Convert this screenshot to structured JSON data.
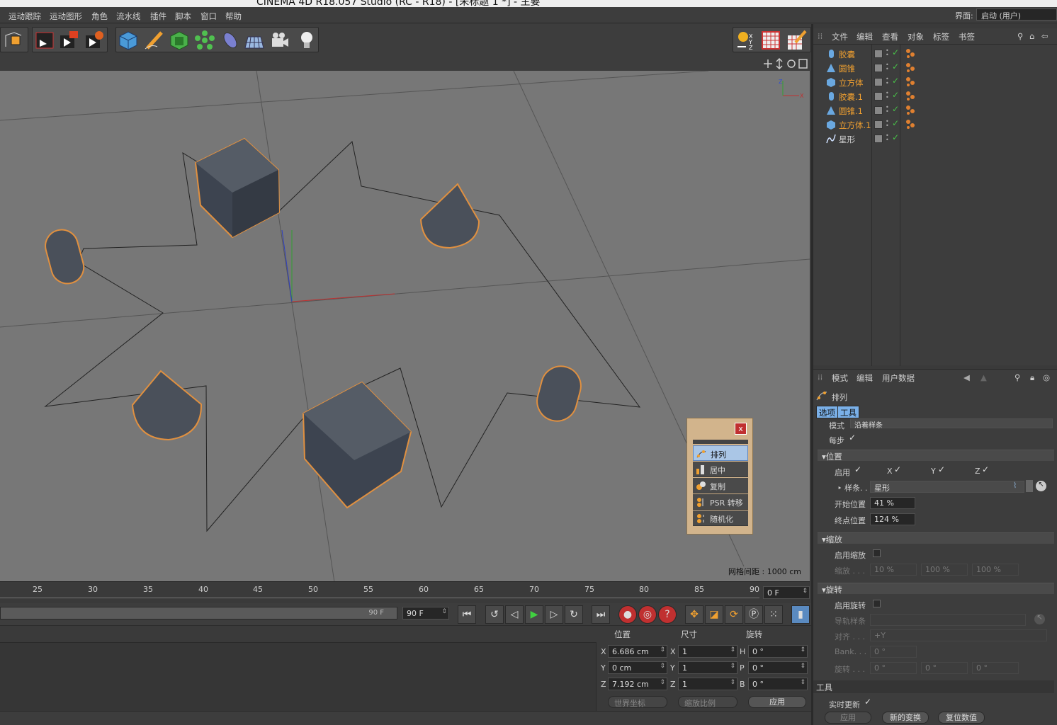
{
  "window": {
    "title": "CINEMA 4D R18.057 Studio (RC - R18) - [未标题 1 *] - 主要"
  },
  "menu": {
    "items": [
      "运动跟踪",
      "运动图形",
      "角色",
      "流水线",
      "插件",
      "脚本",
      "窗口",
      "帮助"
    ],
    "layout_label": "界面:",
    "layout_value": "启动 (用户)"
  },
  "viewport": {
    "grid_spacing": "网格间距 : 1000 cm"
  },
  "arrange_panel": {
    "close": "x",
    "items": [
      "排列",
      "居中",
      "复制",
      "PSR 转移",
      "随机化"
    ]
  },
  "timeline": {
    "ticks": [
      "25",
      "30",
      "35",
      "40",
      "45",
      "50",
      "55",
      "60",
      "65",
      "70",
      "75",
      "80",
      "85",
      "90"
    ],
    "current_frame": "0 F",
    "range_end": "90 F",
    "end_frame": "90 F"
  },
  "coords": {
    "headers": {
      "position": "位置",
      "size": "尺寸",
      "rotation": "旋转"
    },
    "x": {
      "axis": "X",
      "pos": "6.686 cm",
      "size_axis": "X",
      "size": "1",
      "rot_axis": "H",
      "rot": "0 °"
    },
    "y": {
      "axis": "Y",
      "pos": "0 cm",
      "size_axis": "Y",
      "size": "1",
      "rot_axis": "P",
      "rot": "0 °"
    },
    "z": {
      "axis": "Z",
      "pos": "7.192 cm",
      "size_axis": "Z",
      "size": "1",
      "rot_axis": "B",
      "rot": "0 °"
    },
    "world_coord": "世界坐标",
    "scale_ratio": "缩放比例",
    "apply": "应用"
  },
  "object_manager": {
    "menu": [
      "文件",
      "编辑",
      "查看",
      "对象",
      "标签",
      "书签"
    ],
    "objects": [
      {
        "name": "胶囊",
        "type": "capsule",
        "color": "#f0a030"
      },
      {
        "name": "圆锥",
        "type": "cone",
        "color": "#f0a030"
      },
      {
        "name": "立方体",
        "type": "cube",
        "color": "#f0a030"
      },
      {
        "name": "胶囊.1",
        "type": "capsule",
        "color": "#f0a030"
      },
      {
        "name": "圆锥.1",
        "type": "cone",
        "color": "#f0a030"
      },
      {
        "name": "立方体.1",
        "type": "cube",
        "color": "#f0a030"
      },
      {
        "name": "星形",
        "type": "spline",
        "color": "#cfcfcf"
      }
    ]
  },
  "attributes": {
    "menu": [
      "模式",
      "编辑",
      "用户数据"
    ],
    "title": "排列",
    "tabs": [
      "选项",
      "工具"
    ],
    "mode_label": "模式",
    "mode_value": "沿着样条",
    "per_step": "每步",
    "pos_section": "位置",
    "enable": "启用",
    "x": "X",
    "y": "Y",
    "z": "Z",
    "spline_label": "样条. .",
    "spline_value": "星形",
    "start_label": "开始位置",
    "start_value": "41 %",
    "end_label": "终点位置",
    "end_value": "124 %",
    "scale_section": "缩放",
    "enable_scale": "启用缩放",
    "scale_label": "缩放 . . .",
    "scale_values": [
      "10 %",
      "100 %",
      "100 %"
    ],
    "rot_section": "旋转",
    "enable_rot": "启用旋转",
    "rail_label": "导轨样条",
    "align_label": "对齐 . . .",
    "align_value": "+Y",
    "bank_label": "Bank. . .",
    "bank_value": "0 °",
    "rot_label": "旋转 . . .",
    "rot_values": [
      "0 °",
      "0 °",
      "0 °"
    ],
    "tool_section": "工具",
    "realtime": "实时更新",
    "apply": "应用",
    "new_transform": "新的变换",
    "reset": "复位数值"
  }
}
